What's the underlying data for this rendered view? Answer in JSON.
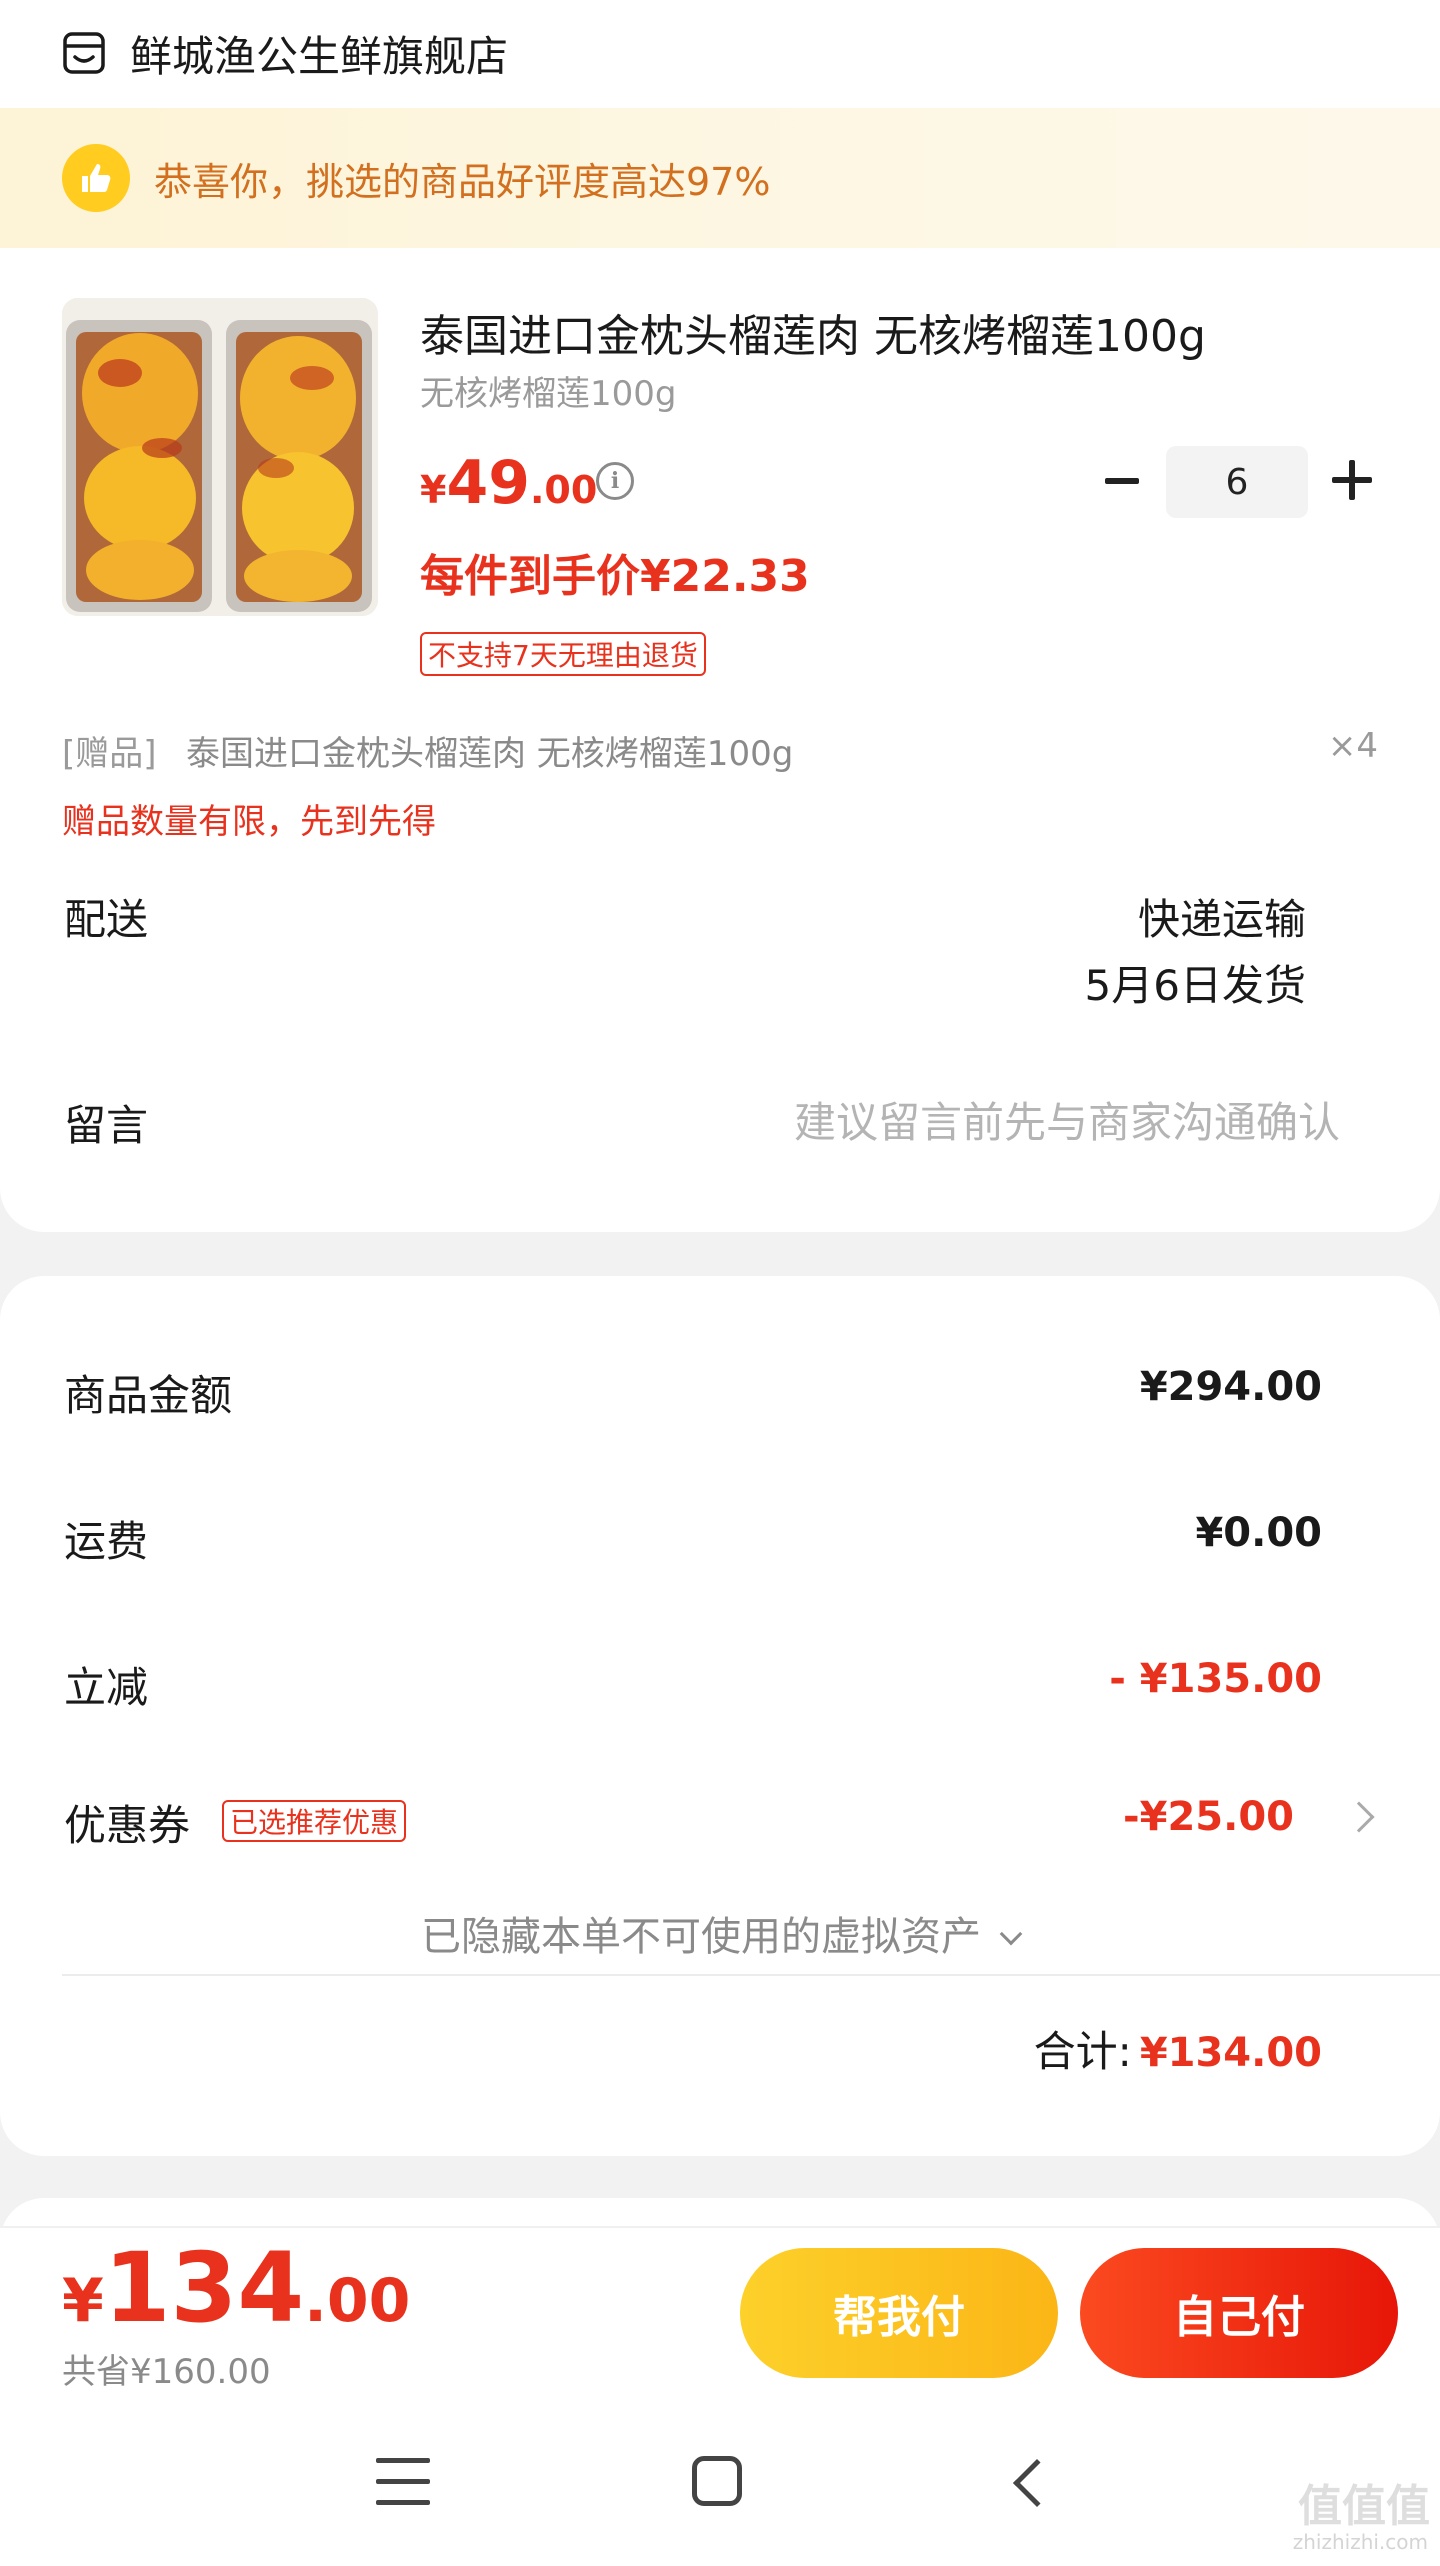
{
  "store": {
    "name": "鲜城渔公生鲜旗舰店",
    "icon": "store-icon"
  },
  "banner": {
    "text": "恭喜你，挑选的商品好评度高达97%",
    "icon": "thumbs-up-icon"
  },
  "product": {
    "title": "泰国进口金枕头榴莲肉 无核烤榴莲100g",
    "spec": "无核烤榴莲100g",
    "price_currency": "¥",
    "price_int": "49",
    "price_dec": ".00",
    "quantity": "6",
    "unit_price": "每件到手价¥22.33",
    "return_policy": "不支持7天无理由退货"
  },
  "gift": {
    "label": "[赠品]",
    "name": "泰国进口金枕头榴莲肉 无核烤榴莲100g",
    "quantity": "×4",
    "note": "赠品数量有限，先到先得"
  },
  "delivery": {
    "label": "配送",
    "method": "快递运输",
    "date": "5月6日发货"
  },
  "message": {
    "label": "留言",
    "placeholder": "建议留言前先与商家沟通确认"
  },
  "summary": {
    "goods_label": "商品金额",
    "goods_value": "¥294.00",
    "shipping_label": "运费",
    "shipping_value": "¥0.00",
    "discount_label": "立减",
    "discount_value": "- ¥135.00",
    "coupon_label": "优惠券",
    "coupon_tag": "已选推荐优惠",
    "coupon_value": "-¥25.00",
    "hidden_assets": "已隐藏本单不可使用的虚拟资产",
    "total_label": "合计:",
    "total_value": "¥134.00"
  },
  "footer": {
    "pay_currency": "¥",
    "pay_int": "134",
    "pay_dec": ".00",
    "saved": "共省¥160.00",
    "help_pay": "帮我付",
    "self_pay": "自己付"
  },
  "watermark": {
    "text": "值值值",
    "sub": "zhizhizhi.com"
  },
  "colors": {
    "accent_red": "#e8321e",
    "banner_orange": "#d2701f",
    "help_yellow": "#fdd02a"
  }
}
